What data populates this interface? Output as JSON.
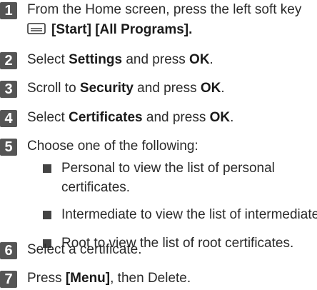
{
  "steps": [
    {
      "num": "1",
      "line1": "From the Home screen, press the left soft key",
      "line2": "[Start] [All Programs]."
    },
    {
      "num": "2",
      "pre": "Select ",
      "bold": "Settings",
      "mid": " and press ",
      "bold2": "OK",
      "post": "."
    },
    {
      "num": "3",
      "pre": "Scroll to ",
      "bold": "Security",
      "mid": " and press ",
      "bold2": "OK",
      "post": "."
    },
    {
      "num": "4",
      "pre": "Select ",
      "bold": "Certificates",
      "mid": " and press ",
      "bold2": "OK",
      "post": "."
    },
    {
      "num": "5",
      "text": "Choose one of the following:"
    },
    {
      "num": "6",
      "text": "Select a certificate."
    },
    {
      "num": "7",
      "pre": "Press ",
      "bold": "[Menu]",
      "post": ", then Delete."
    }
  ],
  "options": [
    {
      "line1": "Personal to view the list of personal",
      "line2": "certificates."
    },
    {
      "line1": "Intermediate to view the list of intermediate"
    },
    {
      "line1": "Root to view the list of root certificates."
    }
  ],
  "icons": {
    "soft_key": "soft-key-icon",
    "bullet": "square-bullet-icon"
  }
}
